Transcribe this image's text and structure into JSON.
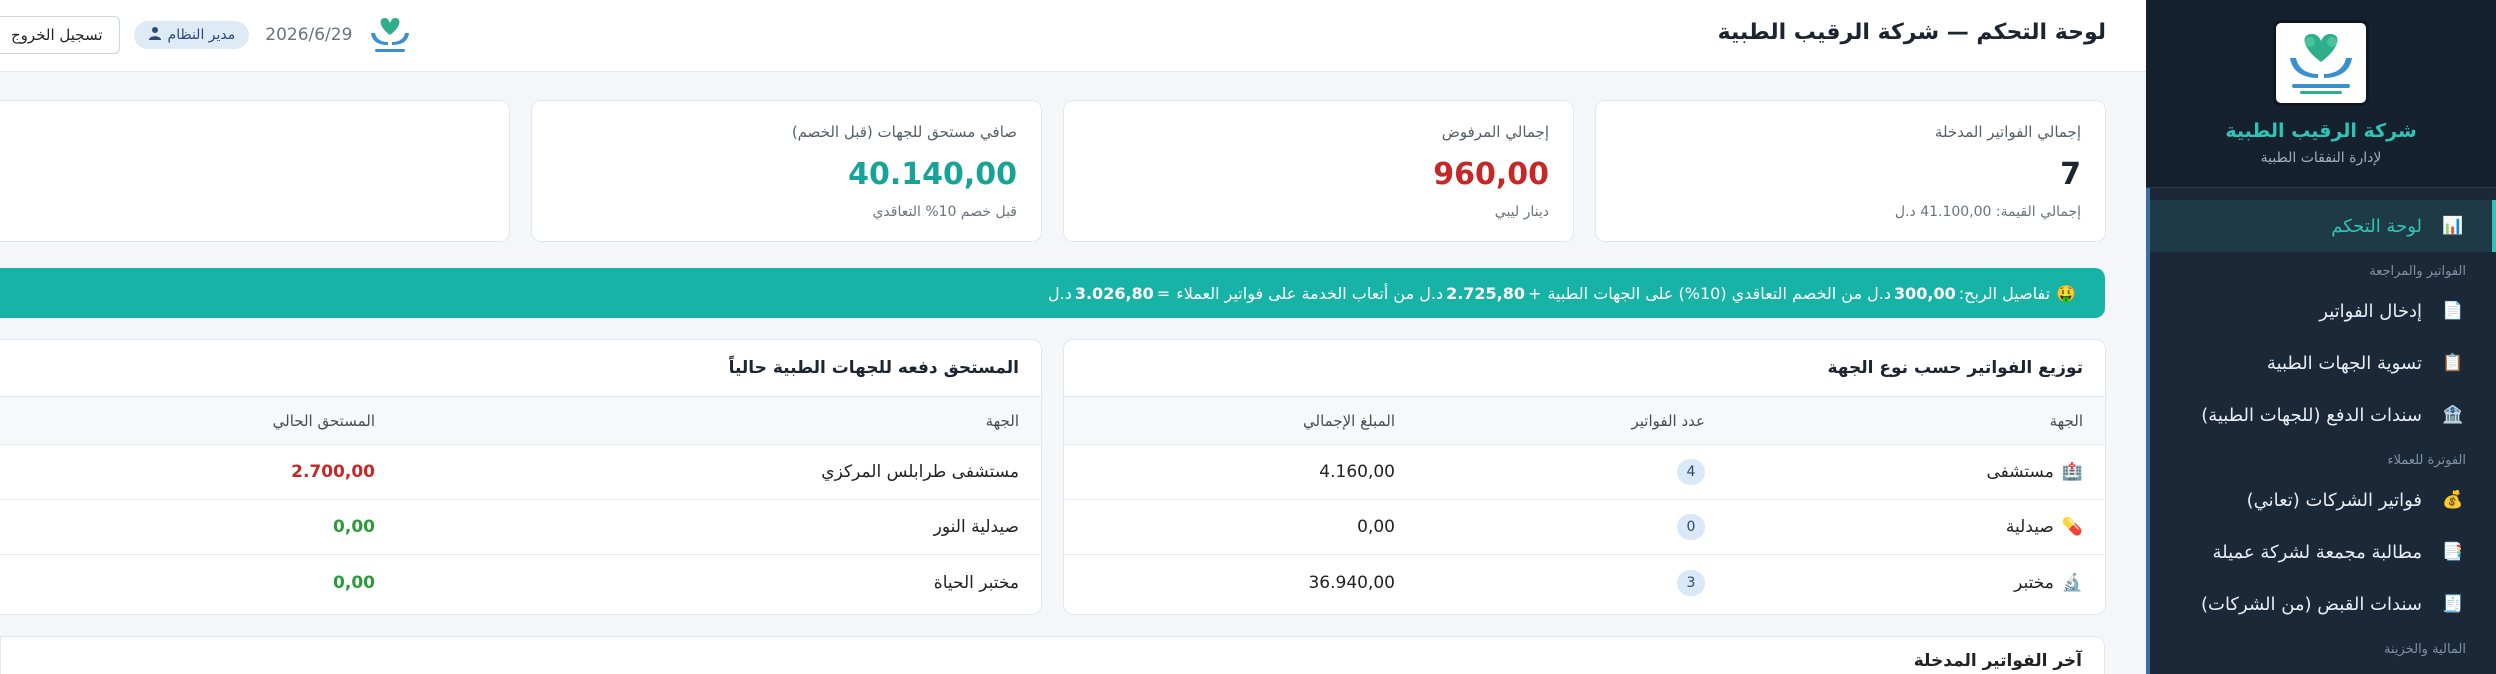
{
  "sidebar": {
    "brand_name": "شركة الرقيب الطبية",
    "brand_sub": "لإدارة النفقات الطبية",
    "logo_text": "شركة الرقيب الطبية لإدارة النفقات الطبية",
    "items": [
      {
        "label": "لوحة التحكم",
        "icon": "chart-icon",
        "glyph": "📊",
        "active": true
      },
      {
        "section": "الفواتير والمراجعة"
      },
      {
        "label": "إدخال الفواتير",
        "icon": "invoice-icon",
        "glyph": "📄"
      },
      {
        "label": "تسوية الجهات الطبية",
        "icon": "clipboard-icon",
        "glyph": "📋"
      },
      {
        "label": "سندات الدفع (للجهات الطبية)",
        "icon": "bank-icon",
        "glyph": "🏦"
      },
      {
        "section": "الفوترة للعملاء"
      },
      {
        "label": "فواتير الشركات (تعاني)",
        "icon": "money-bag-icon",
        "glyph": "💰"
      },
      {
        "label": "مطالبة مجمعة لشركة عميلة",
        "icon": "document-stack-icon",
        "glyph": "📑"
      },
      {
        "label": "سندات القبض (من الشركات)",
        "icon": "receipt-icon",
        "glyph": "🧾"
      },
      {
        "section": "المالية والخزينة"
      }
    ]
  },
  "topbar": {
    "title": "لوحة التحكم — شركة الرقيب الطبية",
    "logout_label": "تسجيل الخروج",
    "role_label": "مدير النظام",
    "date": "2026/6/29"
  },
  "stats": {
    "total_invoices_label": "إجمالي الفواتير المدخلة",
    "total_invoices_value": "7",
    "total_invoices_note": "إجمالي القيمة: 41.100,00 د.ل",
    "rejected_label": "إجمالي المرفوض",
    "rejected_value": "960,00",
    "rejected_note": "دينار ليبي",
    "net_label": "صافي مستحق للجهات (قبل الخصم)",
    "net_value": "40.140,00",
    "net_note": "قبل خصم 10% التعاقدي"
  },
  "profit": {
    "prefix": "تفاصيل الربح:",
    "part1_value": "300,00",
    "part1_text": "د.ل من الخصم التعاقدي (10%) على الجهات الطبية",
    "plus": "+",
    "part2_value": "2.725,80",
    "part2_text": "د.ل من أتعاب الخدمة على فواتير العملاء",
    "equals": "=",
    "total_value": "3.026,80",
    "total_unit": "د.ل"
  },
  "distribution": {
    "title": "توزيع الفواتير حسب نوع الجهة",
    "headers": [
      "الجهة",
      "عدد الفواتير",
      "المبلغ الإجمالي"
    ],
    "rows": [
      {
        "name": "مستشفى",
        "icon": "hospital-icon",
        "glyph": "🏥",
        "count": "4",
        "amount": "4.160,00"
      },
      {
        "name": "صيدلية",
        "icon": "pill-icon",
        "glyph": "💊",
        "count": "0",
        "amount": "0,00"
      },
      {
        "name": "مختبر",
        "icon": "microscope-icon",
        "glyph": "🔬",
        "count": "3",
        "amount": "36.940,00"
      }
    ]
  },
  "due": {
    "title": "المستحق دفعه للجهات الطبية حالياً",
    "headers": [
      "الجهة",
      "المستحق الحالي"
    ],
    "rows": [
      {
        "name": "مستشفى طرابلس المركزي",
        "amount": "2.700,00",
        "status": "red"
      },
      {
        "name": "صيدلية النور",
        "amount": "0,00",
        "status": "green"
      },
      {
        "name": "مختبر الحياة",
        "amount": "0,00",
        "status": "green"
      }
    ]
  },
  "latest": {
    "title": "آخر الفواتير المدخلة"
  },
  "colors": {
    "sidebar_bg": "#1b2838",
    "accent_teal": "#17b3a6",
    "danger_red": "#c62828",
    "success_green": "#2e9a3c"
  }
}
